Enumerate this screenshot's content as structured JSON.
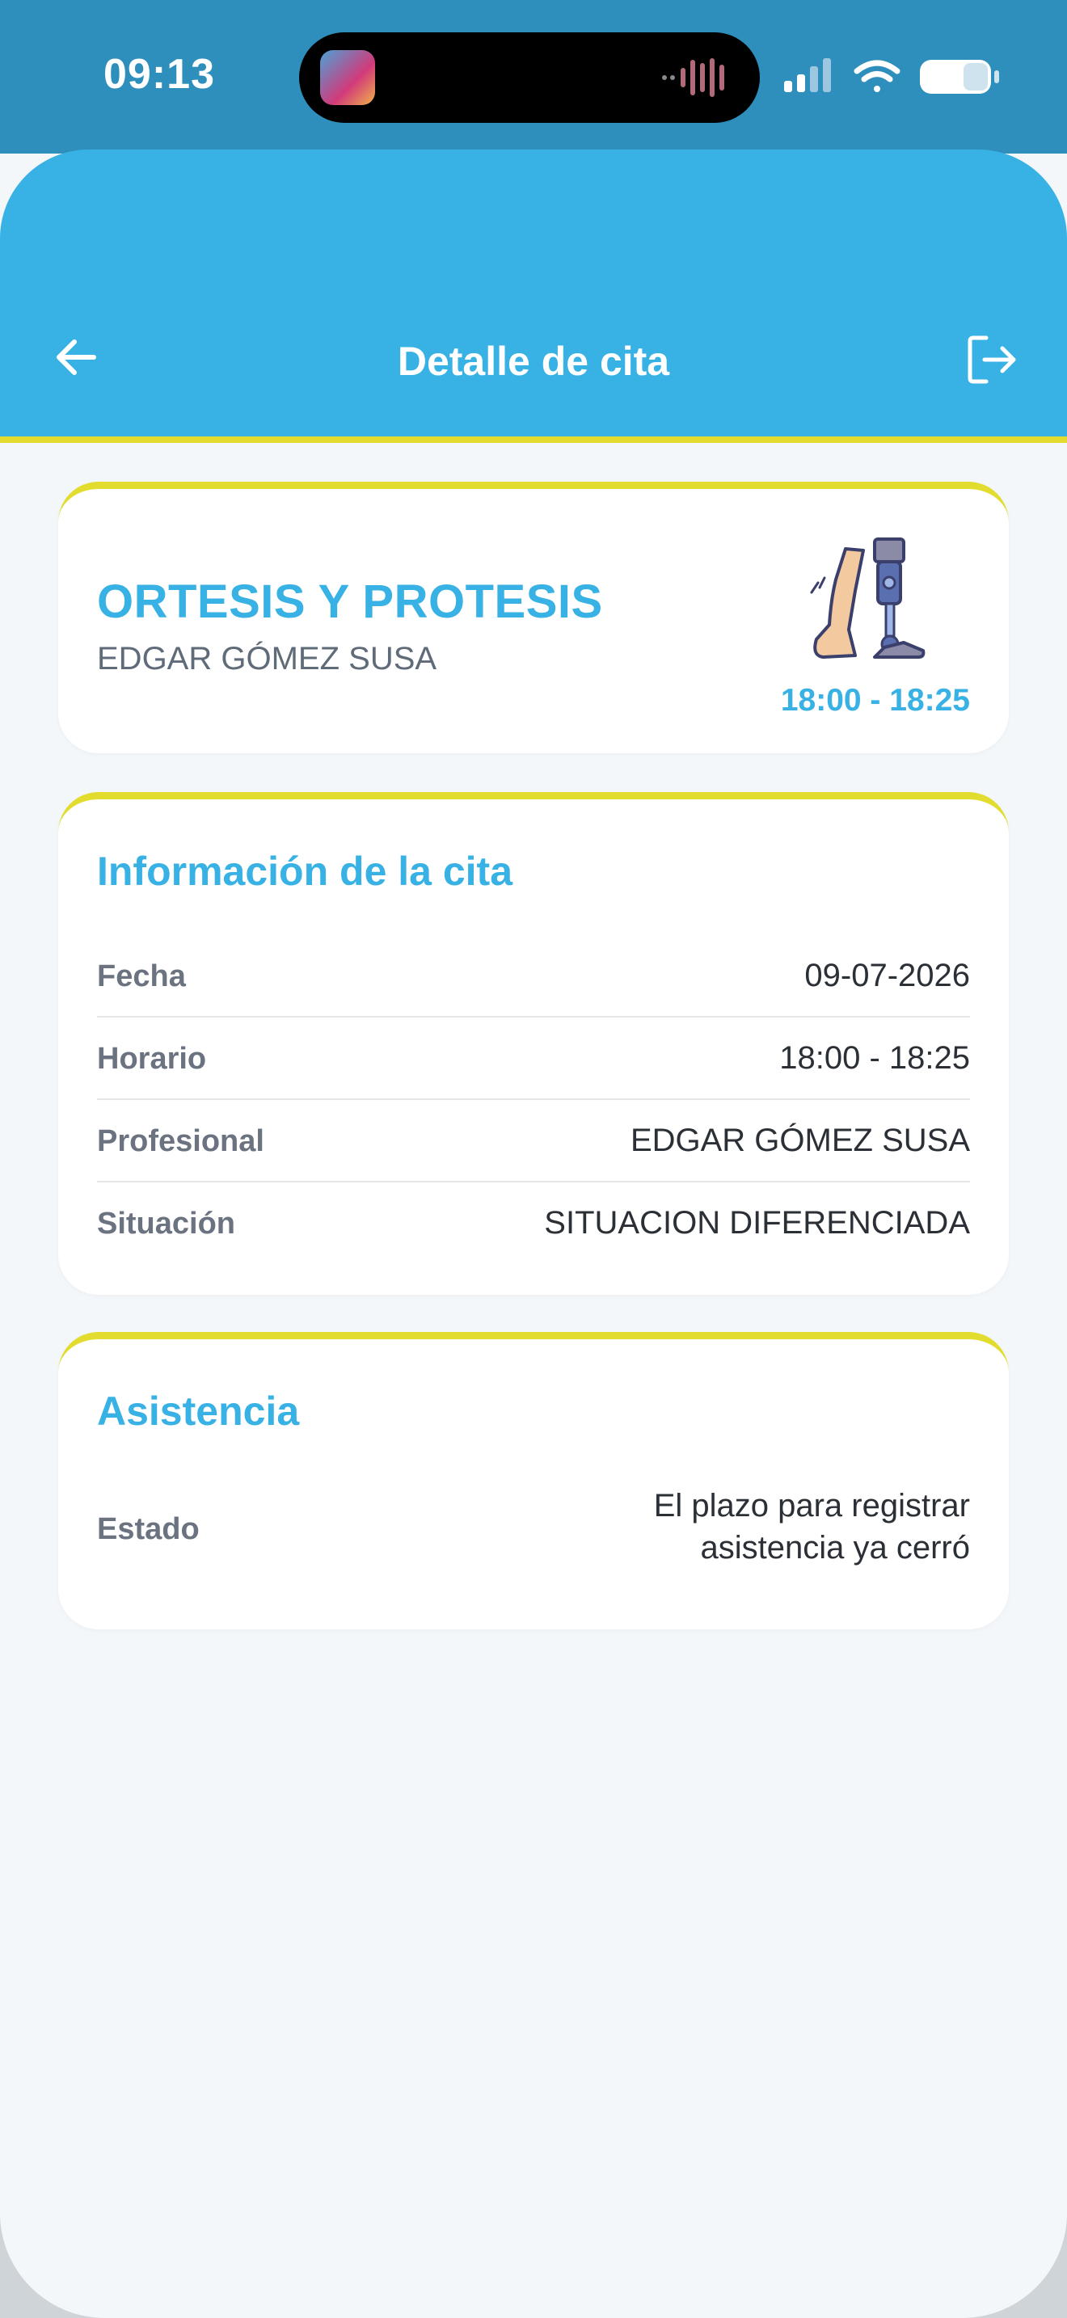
{
  "status_bar": {
    "time": "09:13"
  },
  "header": {
    "title": "Detalle de cita",
    "accent": "#38b1e4",
    "stripe": "#e2dc2e"
  },
  "service": {
    "name": "ORTESIS Y PROTESIS",
    "professional": "EDGAR GÓMEZ SUSA",
    "time": "18:00 - 18:25",
    "icon": "prosthetic-leg-icon"
  },
  "info": {
    "title": "Información de la cita",
    "rows": [
      {
        "label": "Fecha",
        "value": "09-07-2026"
      },
      {
        "label": "Horario",
        "value": "18:00 - 18:25"
      },
      {
        "label": "Profesional",
        "value": "EDGAR GÓMEZ SUSA"
      },
      {
        "label": "Situación",
        "value": "SITUACION DIFERENCIADA"
      }
    ]
  },
  "attendance": {
    "title": "Asistencia",
    "label": "Estado",
    "value": "El plazo para registrar asistencia ya cerró"
  }
}
